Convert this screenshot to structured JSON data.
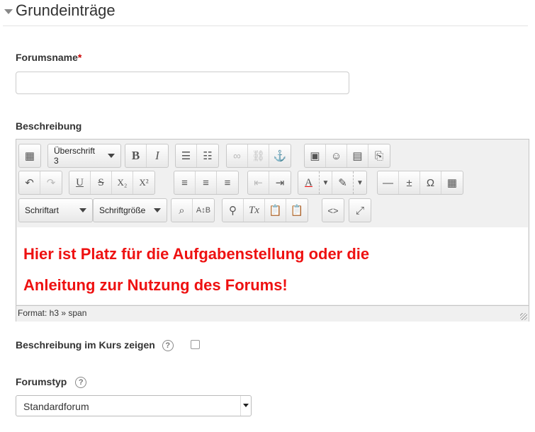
{
  "section": {
    "title": "Grundeinträge"
  },
  "forum_name": {
    "label": "Forumsname",
    "required_mark": "*",
    "value": ""
  },
  "description": {
    "label": "Beschreibung",
    "toolbar": {
      "block_format": "Überschrift 3",
      "font_family": "Schriftart",
      "font_size": "Schriftgröße",
      "bold": "B",
      "italic": "I",
      "underline": "U",
      "strikethrough": "S",
      "subscript": "X₂",
      "superscript": "X²",
      "omega": "Ω",
      "code": "<>",
      "clear_format": "Tx"
    },
    "content_line1": "Hier ist Platz für die Aufgabenstellung oder die",
    "content_line2": "Anleitung zur Nutzung des Forums!",
    "content_color": "#ee1111",
    "status_path": "Format: h3 » span"
  },
  "show_description": {
    "label": "Beschreibung im Kurs zeigen",
    "help": "?",
    "checked": false
  },
  "forum_type": {
    "label": "Forumstyp",
    "help": "?",
    "selected": "Standardforum"
  }
}
